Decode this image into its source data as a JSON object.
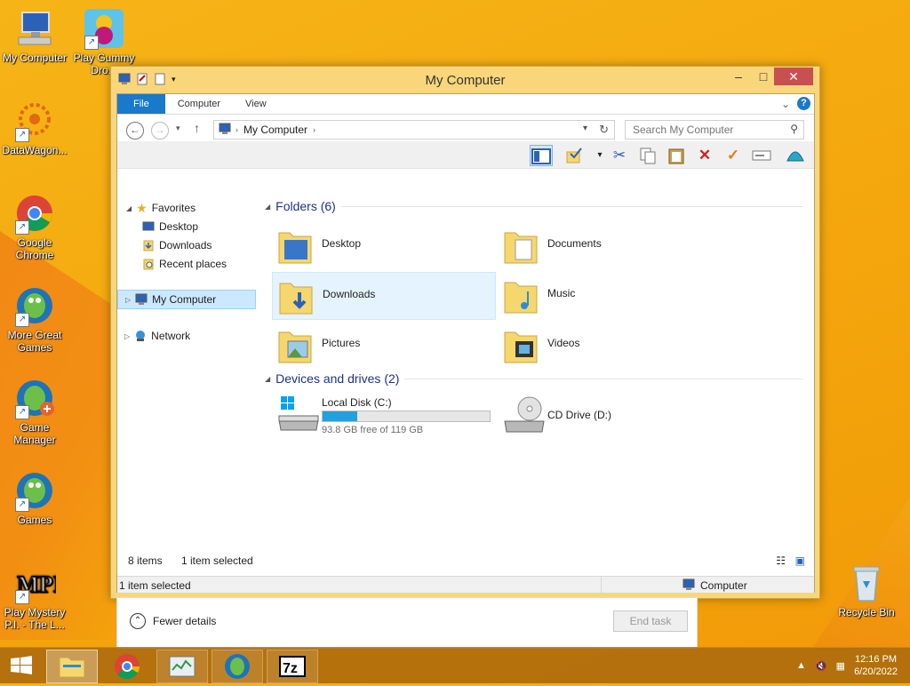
{
  "desktop": {
    "icons": [
      {
        "label": "My Computer"
      },
      {
        "label": "Play Gummy Dro..."
      },
      {
        "label": "DataWagon..."
      },
      {
        "label": "Google Chrome"
      },
      {
        "label": "More Great Games"
      },
      {
        "label": "Game Manager"
      },
      {
        "label": "Games"
      },
      {
        "label": "Play Mystery P.I. - The L..."
      },
      {
        "label": "Recycle Bin"
      }
    ]
  },
  "window": {
    "title": "My Computer",
    "ribbon": {
      "tabs": [
        "File",
        "Computer",
        "View"
      ]
    },
    "address": {
      "path": "My Computer"
    },
    "search": {
      "placeholder": "Search My Computer"
    },
    "nav": {
      "favorites": "Favorites",
      "desktop": "Desktop",
      "downloads": "Downloads",
      "recent": "Recent places",
      "mycomputer": "My Computer",
      "network": "Network"
    },
    "folders_header": "Folders (6)",
    "folders": [
      "Desktop",
      "Documents",
      "Downloads",
      "Music",
      "Pictures",
      "Videos"
    ],
    "devices_header": "Devices and drives (2)",
    "drives": [
      {
        "name": "Local Disk (C:)",
        "free": "93.8 GB free of 119 GB",
        "used_fraction": 0.21
      },
      {
        "name": "CD Drive (D:)"
      }
    ],
    "status": {
      "items": "8 items",
      "selected": "1 item selected"
    },
    "bottom": {
      "left": "1 item selected",
      "right": "Computer"
    }
  },
  "taskmgr": {
    "fewer": "Fewer details",
    "endtask": "End task"
  },
  "taskbar": {
    "time": "12:16 PM",
    "date": "6/20/2022"
  }
}
